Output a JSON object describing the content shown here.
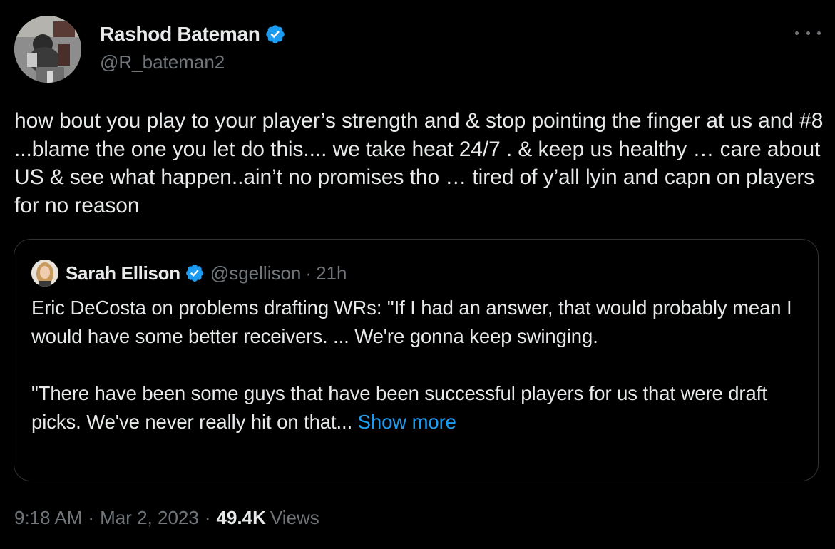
{
  "author": {
    "name": "Rashod Bateman",
    "handle": "@R_bateman2",
    "verified": true,
    "badge_color": "#1d9bf0"
  },
  "menu": {
    "icon": "more-horizontal-icon"
  },
  "tweet": {
    "text": "how bout you play to your player’s strength and & stop pointing the finger at us and #8 ...blame the one you let do this.... we take heat 24/7 . & keep us healthy … care about US & see what happen..ain’t no promises tho … tired of y’all lyin and capn on players for no reason"
  },
  "quote": {
    "name": "Sarah Ellison",
    "handle": "@sgellison",
    "separator": "·",
    "time": "21h",
    "verified": true,
    "text": "Eric DeCosta on problems drafting WRs: \"If I had an answer, that would probably mean I would have some better receivers. ... We're gonna keep swinging.\n\n\"There have been some guys that have been successful players for us that were draft picks. We've never really hit on that... ",
    "show_more": "Show more"
  },
  "meta": {
    "time": "9:18 AM",
    "separator": "·",
    "date": "Mar 2, 2023",
    "views_count": "49.4K",
    "views_label": "Views"
  },
  "colors": {
    "background": "#000000",
    "text_primary": "#e7e9ea",
    "text_secondary": "#71767b",
    "link": "#1d9bf0",
    "border": "#2f3336"
  }
}
